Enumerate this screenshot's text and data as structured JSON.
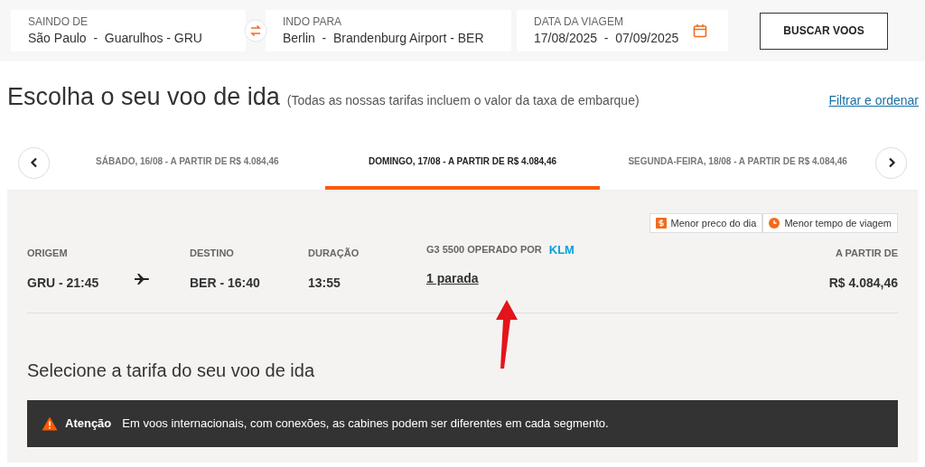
{
  "search_bar": {
    "origin": {
      "label": "SAINDO DE",
      "value": "São Paulo  -  Guarulhos - GRU"
    },
    "destination": {
      "label": "INDO PARA",
      "value": "Berlin  -  Brandenburg Airport - BER"
    },
    "dates": {
      "label": "DATA DA VIAGEM",
      "value": "17/08/2025  -  07/09/2025"
    },
    "search_button": "BUSCAR VOOS"
  },
  "heading": {
    "title": "Escolha o seu voo de ida",
    "note": "(Todas as nossas tarifas incluem o valor da taxa de embarque)",
    "filter_link": "Filtrar e ordenar"
  },
  "date_tabs": [
    {
      "label": "SÁBADO, 16/08 - A PARTIR DE R$ 4.084,46",
      "selected": false
    },
    {
      "label": "DOMINGO, 17/08 - A PARTIR DE R$ 4.084,46",
      "selected": true
    },
    {
      "label": "SEGUNDA-FEIRA, 18/08 - A PARTIR DE R$ 4.084,46",
      "selected": false
    }
  ],
  "badges": [
    {
      "kind": "price",
      "label": "Menor preco do dia"
    },
    {
      "kind": "time",
      "label": "Menor tempo de viagem"
    }
  ],
  "flight": {
    "origin_label": "ORIGEM",
    "origin": "GRU - 21:45",
    "destination_label": "DESTINO",
    "destination": "BER - 16:40",
    "duration_label": "DURAÇÃO",
    "duration": "13:55",
    "operator_label": "G3 5500 OPERADO POR",
    "operator_logo": "KLM",
    "stops": "1 parada",
    "price_label": "A PARTIR DE",
    "price": "R$ 4.084,46"
  },
  "fare_title": "Selecione a tarifa do seu voo de ida",
  "alert": {
    "title": "Atenção",
    "message": "Em voos internacionais, com conexões, as cabines podem ser diferentes em cada segmento."
  }
}
